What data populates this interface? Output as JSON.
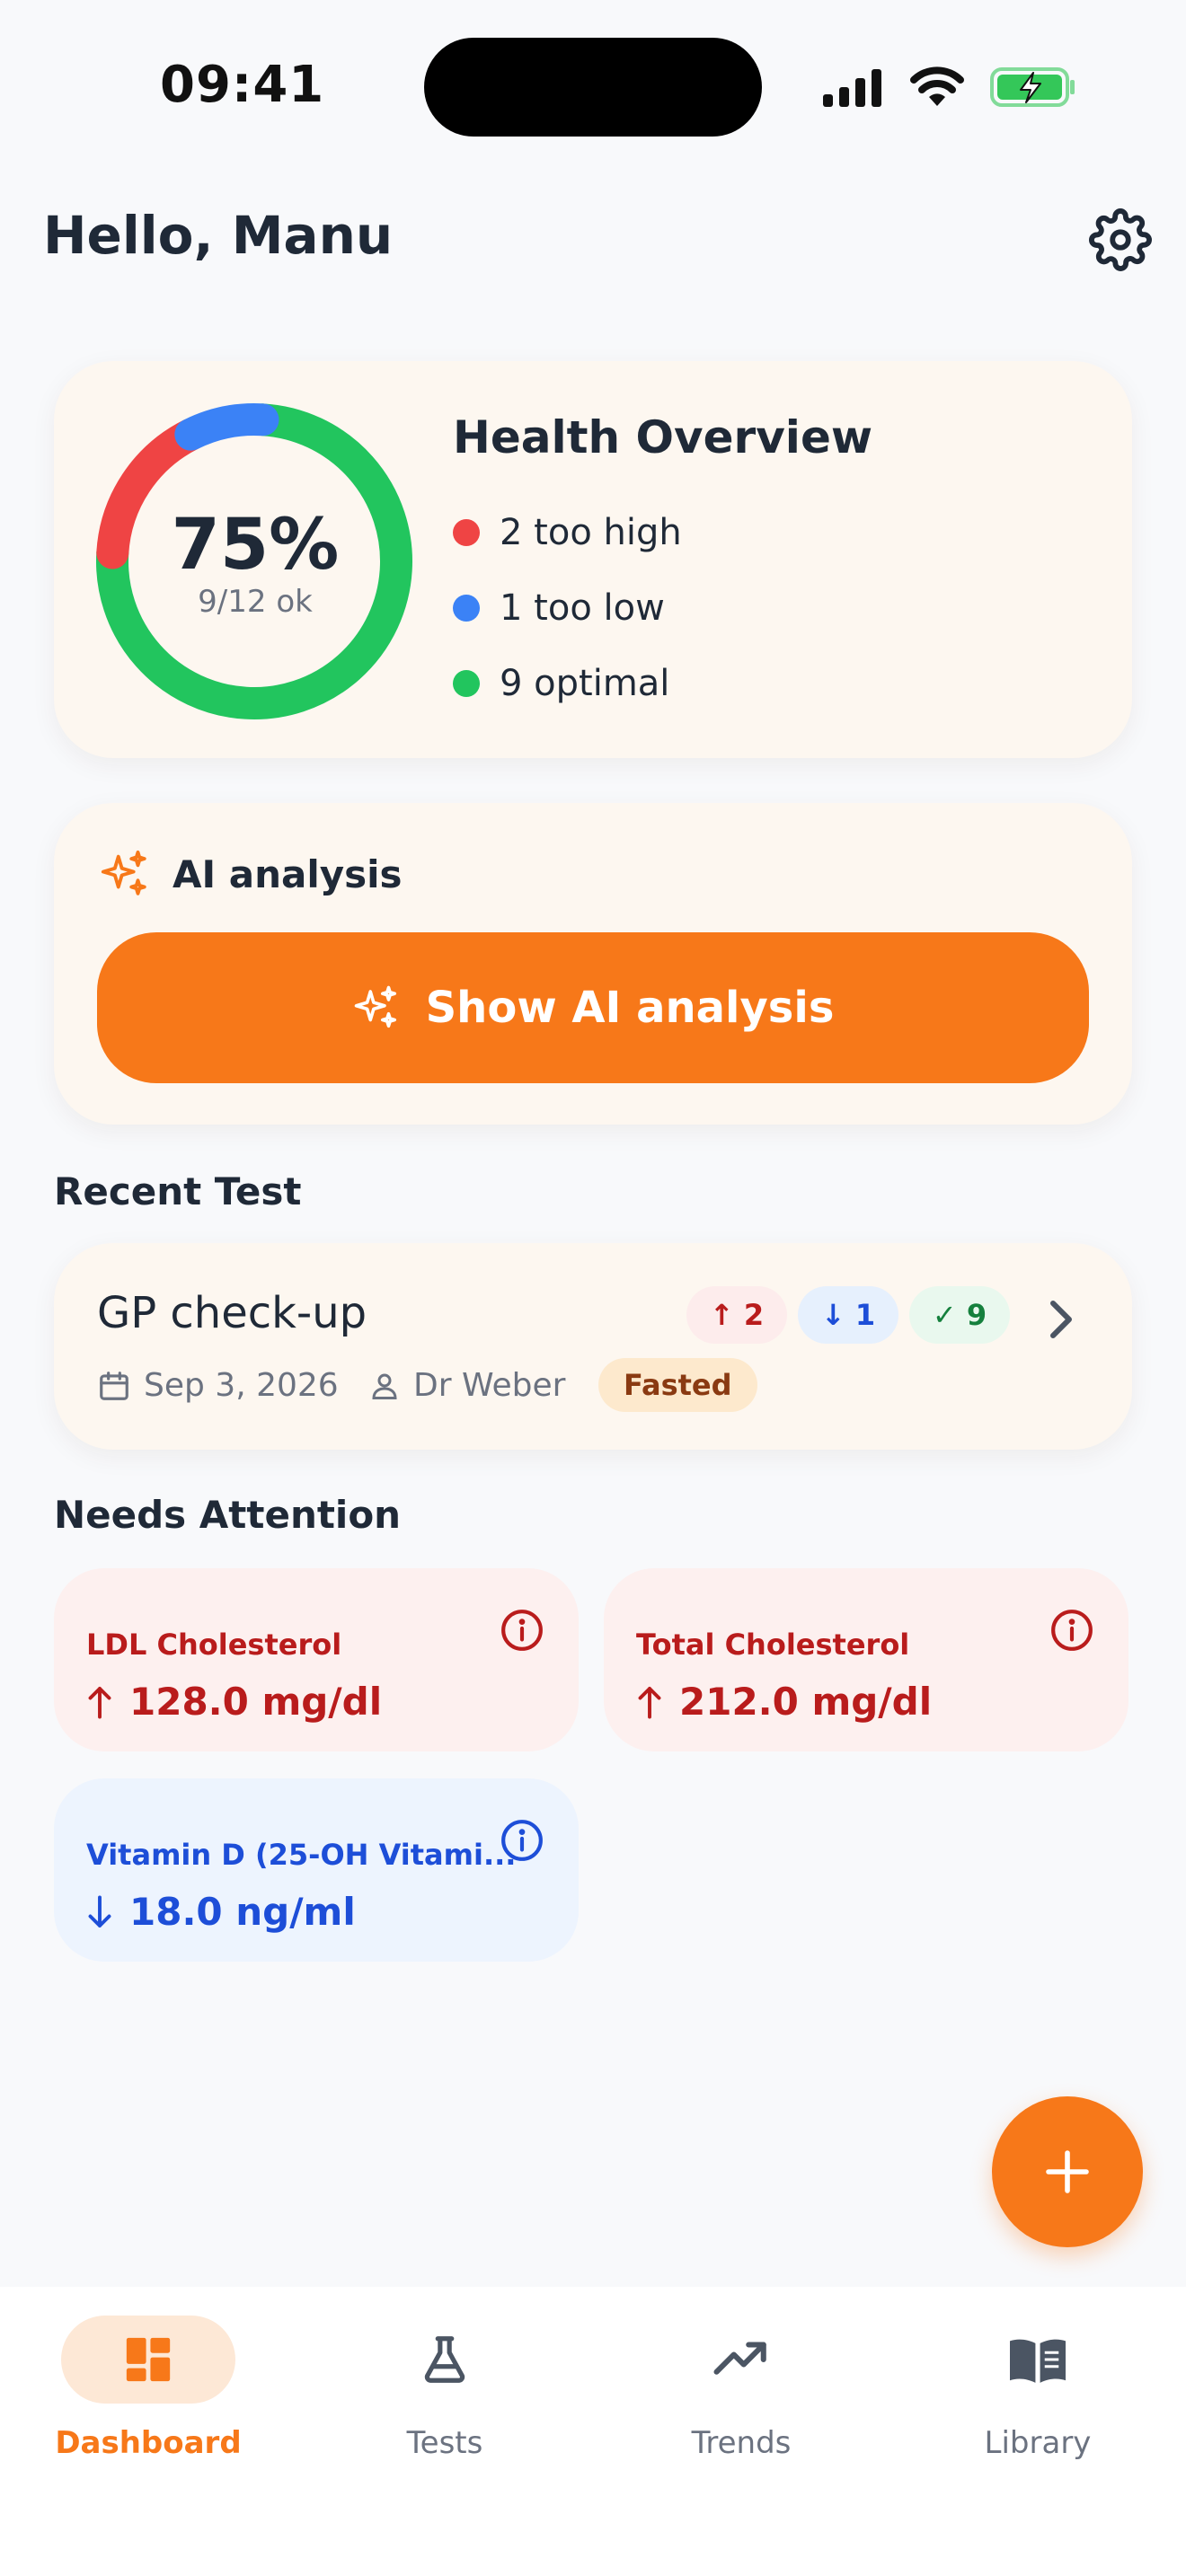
{
  "status_bar": {
    "time": "09:41"
  },
  "header": {
    "greeting": "Hello, Manu"
  },
  "overview": {
    "title": "Health Overview",
    "percent": "75%",
    "sub": "9/12 ok",
    "legend": [
      {
        "label": "2 too high",
        "color": "#ef4444"
      },
      {
        "label": "1 too low",
        "color": "#3b82f6"
      },
      {
        "label": "9 optimal",
        "color": "#22c55e"
      }
    ],
    "counts": {
      "high": 2,
      "low": 1,
      "optimal": 9
    }
  },
  "ai": {
    "title": "AI analysis",
    "button_label": "Show AI analysis",
    "accent": "#f77819"
  },
  "recent": {
    "section_title": "Recent Test",
    "test_name": "GP check-up",
    "high_count": "↑ 2",
    "low_count": "↓ 1",
    "ok_count": "✓ 9",
    "date": "Sep 3, 2026",
    "doctor": "Dr Weber",
    "tag": "Fasted"
  },
  "attention": {
    "section_title": "Needs Attention",
    "items": [
      {
        "name": "LDL Cholesterol",
        "value": "128.0 mg/dl",
        "status": "high"
      },
      {
        "name": "Total Cholesterol",
        "value": "212.0 mg/dl",
        "status": "high"
      },
      {
        "name": "Vitamin D (25-OH Vitami...",
        "value": "18.0 ng/ml",
        "status": "low"
      }
    ]
  },
  "nav": {
    "items": [
      {
        "label": "Dashboard",
        "icon": "dashboard-icon",
        "active": true
      },
      {
        "label": "Tests",
        "icon": "flask-icon",
        "active": false
      },
      {
        "label": "Trends",
        "icon": "trend-icon",
        "active": false
      },
      {
        "label": "Library",
        "icon": "book-icon",
        "active": false
      }
    ]
  }
}
